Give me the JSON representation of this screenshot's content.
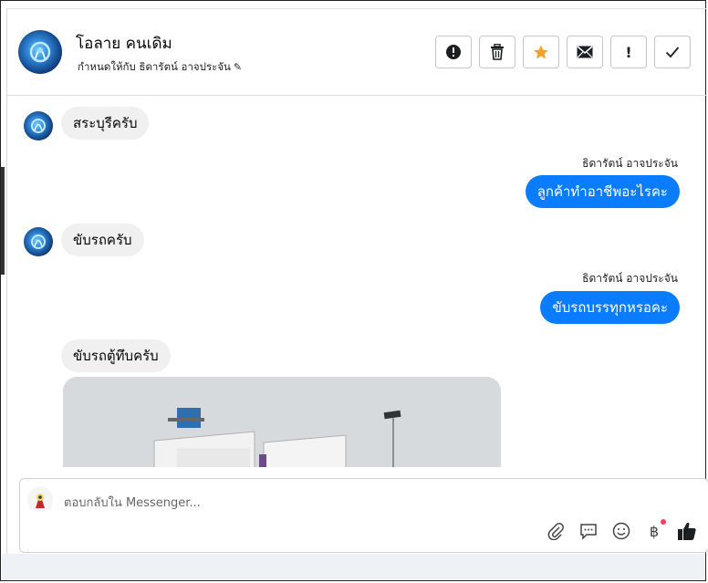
{
  "header": {
    "contact_name": "โอลาย คนเดิม",
    "assigned_label": "กำหนดให้กับ ธิดารัตน์ อาจประจัน",
    "actions": [
      {
        "name": "alert-circle-icon"
      },
      {
        "name": "trash-icon"
      },
      {
        "name": "star-icon"
      },
      {
        "name": "envelope-icon"
      },
      {
        "name": "exclamation-icon"
      },
      {
        "name": "check-icon"
      }
    ]
  },
  "messages": [
    {
      "direction": "in",
      "text": "สระบุรีครับ"
    },
    {
      "direction": "out",
      "sender": "ธิดารัตน์ อาจประจัน",
      "text": "ลูกค้าทำอาชีพอะไรคะ"
    },
    {
      "direction": "in",
      "text": "ขับรถครับ"
    },
    {
      "direction": "out",
      "sender": "ธิดารัตน์ อาจประจัน",
      "text": "ขับรถบรรทุกหรอคะ"
    },
    {
      "direction": "in",
      "text": "ขับรถตู้ทึบครับ"
    }
  ],
  "composer": {
    "placeholder": "ตอบกลับใน Messenger...",
    "tools": [
      "paperclip-icon",
      "speech-bubble-icon",
      "smiley-icon",
      "baht-icon",
      "thumbs-up-icon"
    ]
  },
  "colors": {
    "accent": "#0a7cff",
    "star": "#f5a02a",
    "notification_dot": "#ff3b5c"
  }
}
